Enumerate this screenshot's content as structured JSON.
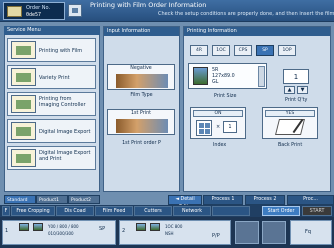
{
  "colors": {
    "accent": "#2f5d8e",
    "panel_bg": "#cfdcea",
    "active_tab": "#3a72b3",
    "start": "#3d7cc1"
  },
  "header": {
    "order_label": "Order No.",
    "order_number": "0de57",
    "title": "Printing with Film Order Information",
    "subtitle": "Check the setup conditions are properly done, and then insert the film and"
  },
  "sidebar": {
    "title": "Service Menu",
    "items": [
      {
        "label": "Printing with Film",
        "icon": "film-print-icon"
      },
      {
        "label": "Variety Print",
        "icon": "variety-print-icon"
      },
      {
        "label": "Printing from Imaging Controller",
        "icon": "imaging-controller-icon"
      },
      {
        "label": "Digital Image Export",
        "icon": "digital-export-icon"
      },
      {
        "label": "Digital Image Export and Print",
        "icon": "digital-export-print-icon"
      }
    ],
    "tabs": [
      "Standard",
      "Product1",
      "Product2"
    ]
  },
  "input_info": {
    "title": "Input Information",
    "film_type": {
      "card_label": "Negative",
      "caption": "Film Type"
    },
    "first_print": {
      "card_label": "1st Print",
      "caption": "1st Print order P"
    }
  },
  "printing_info": {
    "title": "Printing Information",
    "sizes": [
      "4R",
      "1OC",
      "CPS",
      "SP",
      "1OP"
    ],
    "active_size": "SP",
    "print_size": {
      "lines": [
        "5R",
        "127x89.0",
        "GL"
      ],
      "caption": "Print Size"
    },
    "print_count": {
      "value": "1",
      "caption": "Print Q'ty",
      "up": "▲",
      "down": "▼"
    },
    "index": {
      "toggle": "ON",
      "times": "×",
      "count": "1",
      "caption": "Index"
    },
    "back_print": {
      "toggle": "YES",
      "caption": "Back Print"
    }
  },
  "process_tabs": [
    {
      "label": "◄ Detail Edits",
      "active": true
    },
    {
      "label": "Process 1",
      "active": false
    },
    {
      "label": "Process 2",
      "active": false
    },
    {
      "label": "Proc...",
      "active": false
    }
  ],
  "function_bar": {
    "items": [
      "Free Cropping",
      "Dis Coad",
      "Film Feed",
      "Cutters",
      "Network"
    ],
    "start_order": "Start Order",
    "start": "START"
  },
  "film_strip": {
    "cells": [
      {
        "index": "1",
        "lines": [
          "Y00 / 800 / 800",
          "010/300/300"
        ],
        "size_label": "SP"
      },
      {
        "index": "2",
        "lines": [
          "1OC 800",
          "NSH"
        ],
        "size_label": "P/P"
      }
    ],
    "extra": "Fq"
  }
}
